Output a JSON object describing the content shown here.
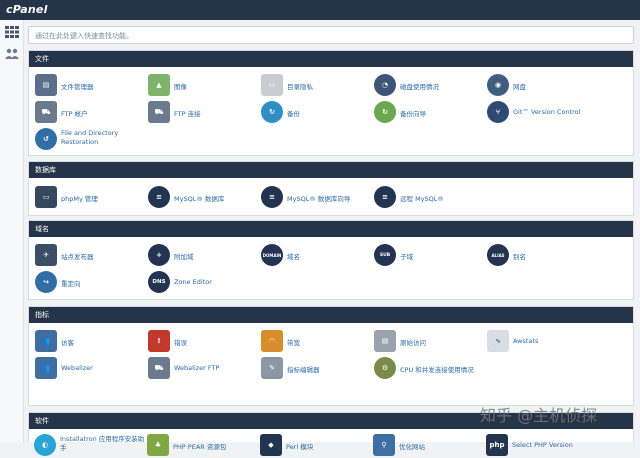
{
  "app": {
    "logo": "cPanel"
  },
  "search": {
    "placeholder": "通过在此处键入快速查找功能。"
  },
  "sections": [
    {
      "title": "文件",
      "items": [
        {
          "label": "文件管理器",
          "icon": "file-manager-icon"
        },
        {
          "label": "图像",
          "icon": "images-icon"
        },
        {
          "label": "目录隐私",
          "icon": "directory-privacy-icon"
        },
        {
          "label": "磁盘使用情况",
          "icon": "disk-usage-icon"
        },
        {
          "label": "网盘",
          "icon": "web-disk-icon"
        },
        {
          "label": "FTP 帐户",
          "icon": "ftp-accounts-icon"
        },
        {
          "label": "FTP 连接",
          "icon": "ftp-connections-icon"
        },
        {
          "label": "备份",
          "icon": "backup-icon"
        },
        {
          "label": "备份向导",
          "icon": "backup-wizard-icon"
        },
        {
          "label": "Git™ Version Control",
          "icon": "git-icon"
        },
        {
          "label": "File and Directory Restoration",
          "icon": "file-restoration-icon"
        }
      ]
    },
    {
      "title": "数据库",
      "items": [
        {
          "label": "phpMy 管理",
          "icon": "phpmyadmin-icon"
        },
        {
          "label": "MySQL® 数据库",
          "icon": "mysql-databases-icon"
        },
        {
          "label": "MySQL® 数据库向导",
          "icon": "mysql-wizard-icon"
        },
        {
          "label": "远程 MySQL®",
          "icon": "remote-mysql-icon"
        }
      ]
    },
    {
      "title": "域名",
      "items": [
        {
          "label": "站点发布器",
          "icon": "site-publisher-icon"
        },
        {
          "label": "附加域",
          "icon": "addon-domains-icon"
        },
        {
          "label": "域名",
          "icon": "domains-icon",
          "badge": "DOMAIN"
        },
        {
          "label": "子域",
          "icon": "subdomains-icon",
          "badge": "SUB"
        },
        {
          "label": "别名",
          "icon": "aliases-icon",
          "badge": "ALIAS"
        },
        {
          "label": "重定向",
          "icon": "redirects-icon"
        },
        {
          "label": "Zone Editor",
          "icon": "zone-editor-icon",
          "badge": "DNS"
        }
      ]
    },
    {
      "title": "指标",
      "items": [
        {
          "label": "访客",
          "icon": "visitors-icon"
        },
        {
          "label": "错误",
          "icon": "errors-icon"
        },
        {
          "label": "带宽",
          "icon": "bandwidth-icon"
        },
        {
          "label": "原始访问",
          "icon": "raw-access-icon"
        },
        {
          "label": "Awstats",
          "icon": "awstats-icon"
        },
        {
          "label": "Webalizer",
          "icon": "webalizer-icon"
        },
        {
          "label": "Webalizer FTP",
          "icon": "webalizer-ftp-icon"
        },
        {
          "label": "指标编辑器",
          "icon": "metrics-editor-icon"
        },
        {
          "label": "CPU 和并发连接使用情况",
          "icon": "cpu-usage-icon"
        }
      ]
    },
    {
      "title": "软件",
      "items": [
        {
          "label": "Installatron 应用程序安装助手",
          "icon": "installatron-icon"
        },
        {
          "label": "PHP PEAR 资源包",
          "icon": "php-pear-icon"
        },
        {
          "label": "Perl 模块",
          "icon": "perl-modules-icon"
        },
        {
          "label": "优化网站",
          "icon": "optimize-website-icon"
        },
        {
          "label": "Select PHP Version",
          "icon": "select-php-icon"
        }
      ]
    }
  ],
  "watermark": "知乎 @主机侦探",
  "colors": {
    "header": "#26344a",
    "link": "#2c6aa6",
    "background": "#f1f2f4"
  }
}
